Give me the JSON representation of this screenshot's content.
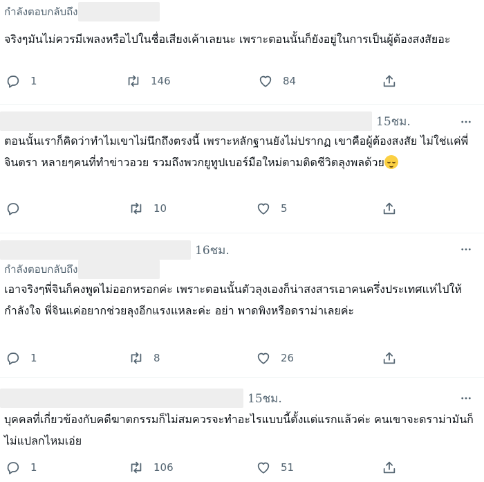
{
  "tweets": [
    {
      "reply_to_label": "กำลังตอบกลับถึง",
      "text": "จริงๆมันไม่ควรมีเพลงหรือไปในชื่อเสียงเค้าเลยนะ เพราะตอนนั้นก็ยังอยู่ในการเป็นผู้ต้องสงสัยอะ",
      "replies": "1",
      "retweets": "146",
      "likes": "84"
    },
    {
      "time": "15ชม.",
      "text": "ตอนนั้นเราก็คิดว่าทำไมเขาไม่นึกถึงตรงนี้ เพราะหลักฐานยังไม่ปรากฏ เขาคือผู้ต้องสงสัย ไม่ใช่แค่พี่จินตรา หลายๆคนที่ทำข่าวอวย รวมถึงพวกยูทูปเบอร์มือใหม่ตามติดชีวิตลุงพลด้วย",
      "emoji": "relieved-face",
      "replies": "",
      "retweets": "10",
      "likes": "5"
    },
    {
      "time": "16ชม.",
      "reply_to_label": "กำลังตอบกลับถึง",
      "text": "เอาจริงๆพี่จินก็คงพูดไม่ออกหรอกค่ะ เพราะตอนนั้นตัวลุงเองก็น่าสงสารเอาคนครึ่งประเทศแห่ไปให้กำลังใจ พี่จินแค่อยากช่วยลุงอีกแรงแหละค่ะ อย่า พาดพิงหรือดราม่าเลยค่ะ",
      "replies": "1",
      "retweets": "8",
      "likes": "26"
    },
    {
      "time": "15ชม.",
      "text": "บุคคลที่เกี่ยวข้องกับคดีฆาตกรรมก็ไม่สมควรจะทำอะไรแบบนี้ตั้งแต่แรกแล้วค่ะ คนเขาจะดราม่ามันก็ไม่แปลกไหมเอ่ย",
      "replies": "1",
      "retweets": "106",
      "likes": "51"
    }
  ],
  "icons": {
    "reply": "reply-icon",
    "retweet": "retweet-icon",
    "like": "heart-icon",
    "share": "share-icon",
    "more": "more-icon"
  },
  "colors": {
    "text": "#0f1419",
    "secondary": "#536471",
    "divider": "#eff3f4",
    "redaction": "#eeeeee"
  }
}
